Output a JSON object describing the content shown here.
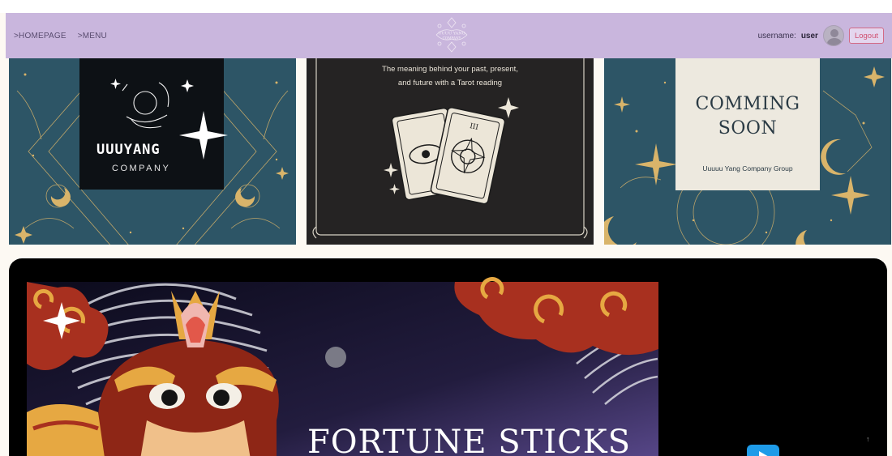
{
  "nav": {
    "homepage": ">HOMEPAGE",
    "menu": ">MENU",
    "logo_line1": "UUUU YANG",
    "logo_line2": "COMPANY",
    "username_label": "username:",
    "username_value": "user",
    "logout": "Logout"
  },
  "cards": [
    {
      "name": "uuuyang-company",
      "brand": "UUUYANG",
      "subtitle": "COMPANY"
    },
    {
      "name": "tarot-reading",
      "text_line1": "The meaning behind your past, present,",
      "text_line2": "and future with a Tarot reading",
      "card_numeral": "III"
    },
    {
      "name": "coming-soon",
      "title_line1": "COMMING",
      "title_line2": "SOON",
      "subtitle": "Uuuuu Yang Company Group"
    }
  ],
  "banner": {
    "title": "FORTUNE STICKS",
    "scroll_top_icon": "↑"
  },
  "icons": {
    "avatar": "user-avatar-icon",
    "play": "play-icon",
    "scroll_top": "arrow-up-icon"
  },
  "colors": {
    "navbar_bg": "#c9b6dd",
    "logout_border": "#d36a86",
    "teal_card": "#2d5566",
    "gold": "#d9b46a",
    "dragon_red": "#a8301f",
    "banner_purple": "#5b4a8e"
  }
}
